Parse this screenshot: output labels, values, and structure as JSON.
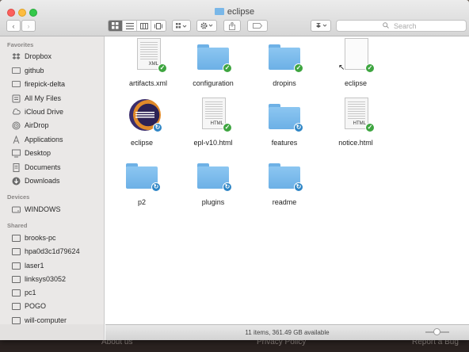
{
  "window": {
    "title": "eclipse"
  },
  "toolbar": {
    "back": "‹",
    "forward": "›",
    "search_placeholder": "Search"
  },
  "sidebar": {
    "favorites_header": "Favorites",
    "favorites": [
      {
        "label": "Dropbox",
        "icon": "dropbox-icon"
      },
      {
        "label": "github",
        "icon": "folder-icon"
      },
      {
        "label": "firepick-delta",
        "icon": "folder-icon"
      },
      {
        "label": "All My Files",
        "icon": "all-files-icon"
      },
      {
        "label": "iCloud Drive",
        "icon": "cloud-icon"
      },
      {
        "label": "AirDrop",
        "icon": "airdrop-icon"
      },
      {
        "label": "Applications",
        "icon": "applications-icon"
      },
      {
        "label": "Desktop",
        "icon": "desktop-icon"
      },
      {
        "label": "Documents",
        "icon": "documents-icon"
      },
      {
        "label": "Downloads",
        "icon": "downloads-icon"
      }
    ],
    "devices_header": "Devices",
    "devices": [
      {
        "label": "WINDOWS",
        "icon": "drive-icon"
      }
    ],
    "shared_header": "Shared",
    "shared": [
      {
        "label": "brooks-pc",
        "icon": "monitor-icon"
      },
      {
        "label": "hpa0d3c1d79624",
        "icon": "monitor-icon"
      },
      {
        "label": "laser1",
        "icon": "monitor-icon"
      },
      {
        "label": "linksys03052",
        "icon": "monitor-icon"
      },
      {
        "label": "pc1",
        "icon": "monitor-icon"
      },
      {
        "label": "POGO",
        "icon": "monitor-icon"
      },
      {
        "label": "will-computer",
        "icon": "monitor-icon"
      }
    ]
  },
  "files": [
    {
      "name": "artifacts.xml",
      "kind": "doc",
      "ext": "XML",
      "status": "synced"
    },
    {
      "name": "configuration",
      "kind": "folder",
      "status": "synced"
    },
    {
      "name": "dropins",
      "kind": "folder",
      "status": "synced"
    },
    {
      "name": "eclipse",
      "kind": "alias",
      "status": "synced"
    },
    {
      "name": "eclipse",
      "kind": "app",
      "status": "syncing"
    },
    {
      "name": "epl-v10.html",
      "kind": "doc",
      "ext": "HTML",
      "status": "synced"
    },
    {
      "name": "features",
      "kind": "folder",
      "status": "syncing"
    },
    {
      "name": "notice.html",
      "kind": "doc",
      "ext": "HTML",
      "status": "synced"
    },
    {
      "name": "p2",
      "kind": "folder",
      "status": "syncing"
    },
    {
      "name": "plugins",
      "kind": "folder",
      "status": "syncing"
    },
    {
      "name": "readme",
      "kind": "folder",
      "status": "syncing"
    }
  ],
  "status": {
    "text": "11 items, 361.49 GB available"
  },
  "background_links": [
    "About us",
    "Privacy Policy",
    "Report a Bug"
  ]
}
